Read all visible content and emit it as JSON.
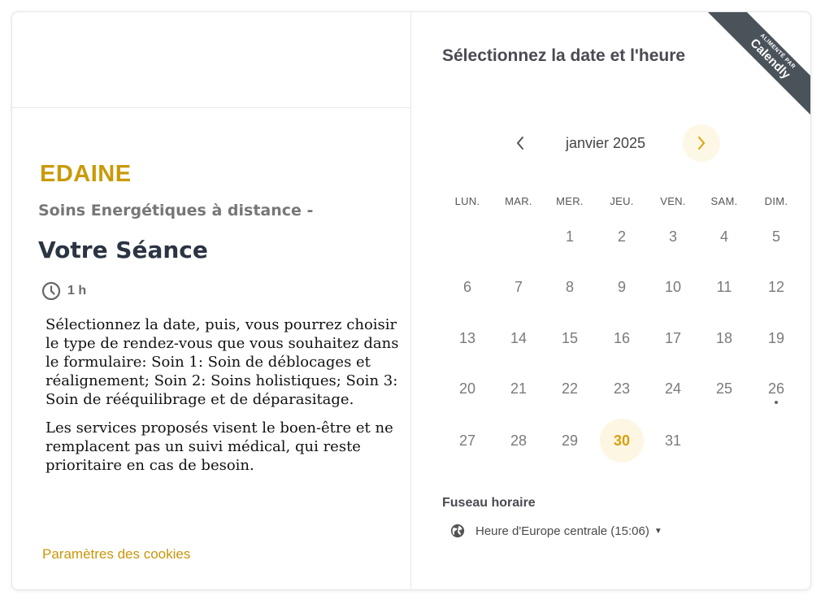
{
  "left": {
    "brand": "EDAINE",
    "subtitle": "Soins Energétiques à distance -",
    "event_title": "Votre Séance",
    "duration": "1 h",
    "description_1": "Sélectionnez la date, puis, vous pourrez choisir le type de rendez-vous que vous souhaitez dans le formulaire: Soin 1: Soin de déblocages et réalignement; Soin 2: Soins holistiques; Soin 3: Soin de rééquilibrage et de déparasitage.",
    "description_2": "Les services proposés visent le boen-être et ne remplacent pas un suivi médical, qui reste prioritaire en cas de besoin.",
    "cookies_link": "Paramètres des cookies"
  },
  "right": {
    "title": "Sélectionnez la date et l'heure",
    "ribbon_small": "ALIMENTÉ PAR",
    "ribbon_big": "Calendly",
    "month": "janvier 2025",
    "weekdays": [
      "LUN.",
      "MAR.",
      "MER.",
      "JEU.",
      "VEN.",
      "SAM.",
      "DIM."
    ],
    "days": [
      "1",
      "2",
      "3",
      "4",
      "5",
      "6",
      "7",
      "8",
      "9",
      "10",
      "11",
      "12",
      "13",
      "14",
      "15",
      "16",
      "17",
      "18",
      "19",
      "20",
      "21",
      "22",
      "23",
      "24",
      "25",
      "26",
      "27",
      "28",
      "29",
      "30",
      "31"
    ],
    "today": "30",
    "dot_day": "26",
    "timezone_label": "Fuseau horaire",
    "timezone_value": "Heure d'Europe centrale (15:06)"
  },
  "colors": {
    "accent": "#c99a06",
    "today_bg": "#fdf6e2",
    "ribbon": "#4a525a"
  },
  "icons": [
    "clock-icon",
    "chevron-left-icon",
    "chevron-right-icon",
    "globe-icon",
    "caret-down-icon"
  ]
}
